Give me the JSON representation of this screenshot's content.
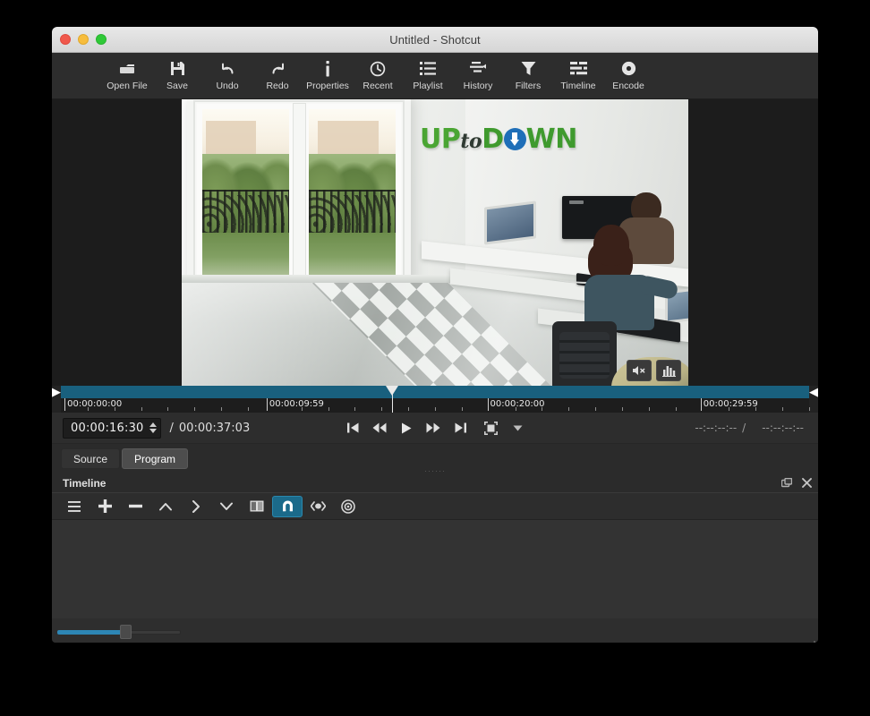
{
  "window": {
    "title": "Untitled - Shotcut",
    "controls": {
      "close": "close",
      "minimize": "minimize",
      "maximize": "maximize"
    }
  },
  "toolbar": {
    "items": [
      {
        "label": "Open File",
        "icon": "open-folder-icon"
      },
      {
        "label": "Save",
        "icon": "floppy-disk-icon"
      },
      {
        "label": "Undo",
        "icon": "undo-arrow-icon"
      },
      {
        "label": "Redo",
        "icon": "redo-arrow-icon"
      },
      {
        "label": "Properties",
        "icon": "info-icon"
      },
      {
        "label": "Recent",
        "icon": "clock-icon"
      },
      {
        "label": "Playlist",
        "icon": "list-icon"
      },
      {
        "label": "History",
        "icon": "history-icon"
      },
      {
        "label": "Filters",
        "icon": "funnel-icon"
      },
      {
        "label": "Timeline",
        "icon": "timeline-icon"
      },
      {
        "label": "Encode",
        "icon": "disc-icon"
      }
    ]
  },
  "player": {
    "scene_description": "Office interior with tall white French windows, balcony railing, green trees outside, checkered marble floor, three people working at white desks with laptops and a monitor",
    "wall_logo": {
      "part1": "UP",
      "part2": "to",
      "part3": "D",
      "part4": "O",
      "part5": "WN"
    },
    "overlay_buttons": [
      {
        "name": "mute-button",
        "icon": "speaker-mute-icon"
      },
      {
        "name": "audio-levels-button",
        "icon": "audio-meter-icon"
      }
    ]
  },
  "ruler": {
    "labels": [
      "00:00:00:00",
      "00:00:09:59",
      "00:00:20:00",
      "00:00:29:59"
    ],
    "label_positions_pct": [
      0.5,
      27.5,
      57.0,
      85.5
    ],
    "playhead_pct": 44.3,
    "in_marker": "▶",
    "out_marker": "◀",
    "bar_color": "#19607e"
  },
  "transport": {
    "current_timecode": "00:00:16:30",
    "separator": "/",
    "total_timecode": "00:00:37:03",
    "buttons": [
      {
        "name": "skip-to-start-button",
        "icon": "skip-previous-icon"
      },
      {
        "name": "rewind-button",
        "icon": "rewind-icon"
      },
      {
        "name": "play-button",
        "icon": "play-icon"
      },
      {
        "name": "fast-forward-button",
        "icon": "fast-forward-icon"
      },
      {
        "name": "skip-to-end-button",
        "icon": "skip-next-icon"
      },
      {
        "name": "grab-frame-button",
        "icon": "selection-square-icon"
      },
      {
        "name": "player-options-dropdown",
        "icon": "chevron-down-icon"
      }
    ],
    "selection_in": "--:--:--:--",
    "selection_sep": "/",
    "selection_out": "--:--:--:--"
  },
  "tabs": [
    {
      "label": "Source",
      "active": false
    },
    {
      "label": "Program",
      "active": true
    }
  ],
  "timeline_panel": {
    "title": "Timeline",
    "title_buttons": [
      {
        "name": "float-panel-button",
        "icon": "undock-icon"
      },
      {
        "name": "close-panel-button",
        "icon": "close-icon"
      }
    ],
    "tools": [
      {
        "name": "timeline-menu-button",
        "icon": "hamburger-menu-icon",
        "active": false
      },
      {
        "name": "append-button",
        "icon": "plus-icon",
        "active": false
      },
      {
        "name": "ripple-delete-button",
        "icon": "minus-icon",
        "active": false
      },
      {
        "name": "lift-button",
        "icon": "chevron-up-icon",
        "active": false
      },
      {
        "name": "overwrite-button",
        "icon": "chevron-right-icon",
        "active": false
      },
      {
        "name": "split-button",
        "icon": "chevron-down-icon",
        "active": false
      },
      {
        "name": "toggle-track-button",
        "icon": "split-view-icon",
        "active": false
      },
      {
        "name": "snap-button",
        "icon": "magnet-icon",
        "active": true
      },
      {
        "name": "scrub-while-dragging-button",
        "icon": "scrub-icon",
        "active": false
      },
      {
        "name": "ripple-all-tracks-button",
        "icon": "target-icon",
        "active": false
      }
    ],
    "zoom_slider": {
      "value_pct": 55
    }
  },
  "colors": {
    "accent_blue": "#2d86b5",
    "ruler_blue": "#19607e",
    "active_tool": "#1b6a8a",
    "panel_bg": "#2d2d2d",
    "timeline_bg": "#333333"
  }
}
